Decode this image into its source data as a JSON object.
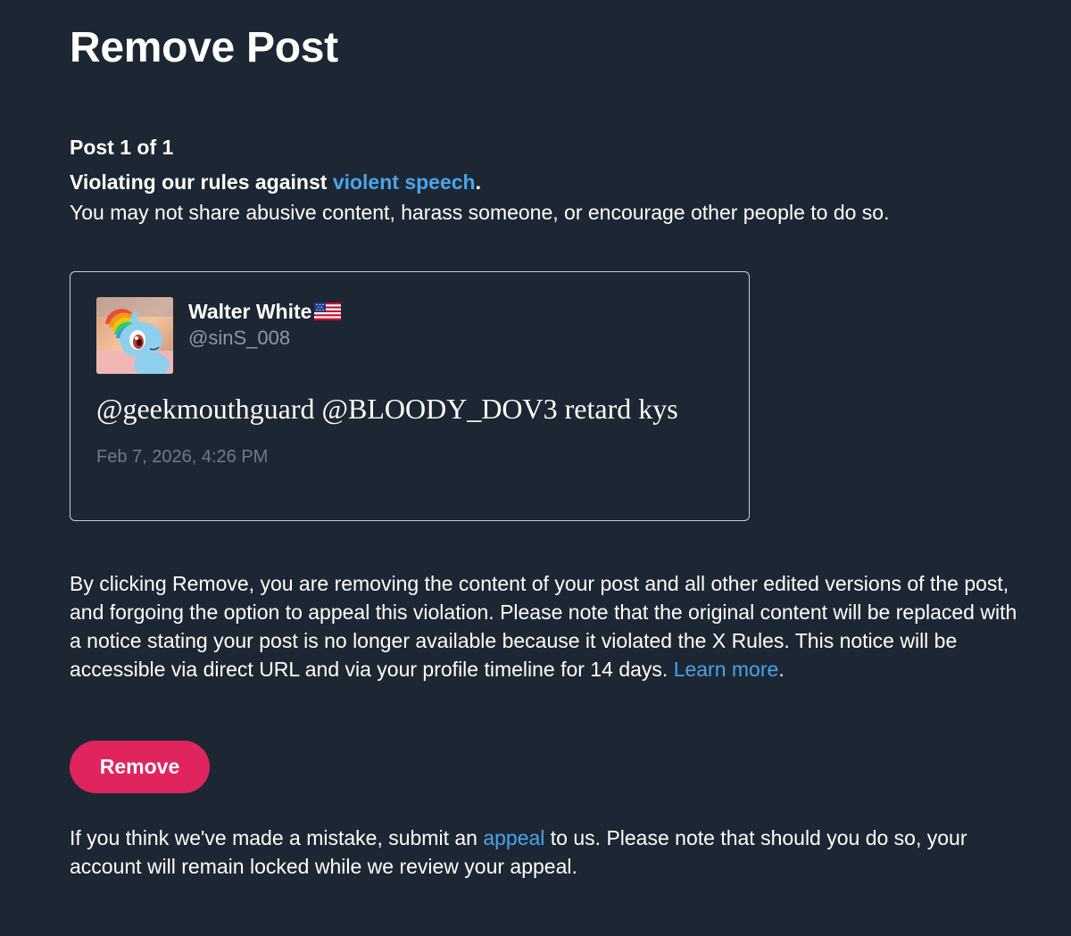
{
  "page_title": "Remove Post",
  "post_counter": "Post 1 of 1",
  "violation": {
    "prefix": "Violating our rules against ",
    "rule_link": "violent speech",
    "suffix": ".",
    "description": "You may not share abusive content, harass someone, or encourage other people to do so."
  },
  "post": {
    "author_name": "Walter White",
    "flag_icon": "us-flag-icon",
    "author_handle": "@sinS_008",
    "text": "@geekmouthguard @BLOODY_DOV3 retard kys",
    "timestamp": "Feb 7, 2026, 4:26 PM",
    "avatar_icon": "pony-avatar"
  },
  "notice": {
    "text": "By clicking Remove, you are removing the content of your post and all other edited versions of the post, and forgoing the option to appeal this violation. Please note that the original content will be replaced with a notice stating your post is no longer available because it violated the X Rules. This notice will be accessible via direct URL and via your profile timeline for 14 days. ",
    "learn_more_link": "Learn more",
    "suffix": "."
  },
  "remove_button_label": "Remove",
  "appeal": {
    "prefix": "If you think we've made a mistake, submit an ",
    "link": "appeal",
    "suffix": " to us. Please note that should you do so, your account will remain locked while we review your appeal."
  },
  "colors": {
    "background": "#1c2733",
    "link": "#4ba3e8",
    "remove_button": "#e0245e",
    "secondary_text": "#8b98a5"
  }
}
